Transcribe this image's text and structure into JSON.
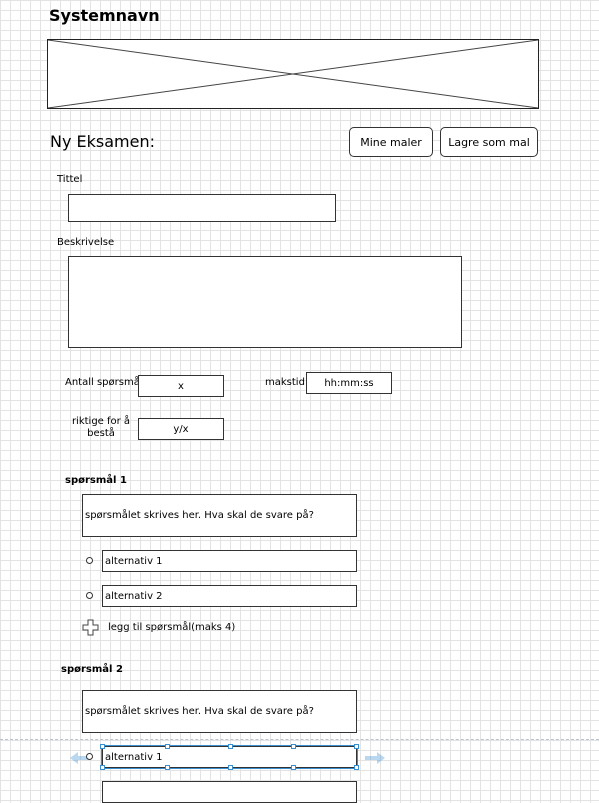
{
  "header": {
    "system_name": "Systemnavn"
  },
  "page": {
    "title": "Ny Eksamen:",
    "my_templates_button": "Mine maler",
    "save_template_button": "Lagre som mal"
  },
  "form": {
    "title_label": "Tittel",
    "description_label": "Beskrivelse",
    "question_count_label": "Antall spørsmål",
    "question_count_value": "x",
    "max_time_label": "makstid",
    "max_time_value": "hh:mm:ss",
    "correct_to_pass_label": "riktige for å bestå",
    "correct_to_pass_value": "y/x"
  },
  "questions": [
    {
      "title": "spørsmål 1",
      "prompt": "spørsmålet skrives her. Hva skal de svare på?",
      "alternatives": [
        "alternativ 1",
        "alternativ 2"
      ],
      "add_alternative_label": "legg til spørsmål(maks 4)"
    },
    {
      "title": "spørsmål 2",
      "prompt": "spørsmålet skrives her. Hva skal de svare på?",
      "alternatives": [
        "alternativ 1"
      ]
    }
  ],
  "icons": {
    "image_placeholder": "image-placeholder-icon",
    "add": "plus-icon",
    "radio": "radio-button-icon"
  },
  "colors": {
    "grid_line": "#e3e3e3",
    "border": "#333333",
    "selection": "#3a8fd1"
  }
}
